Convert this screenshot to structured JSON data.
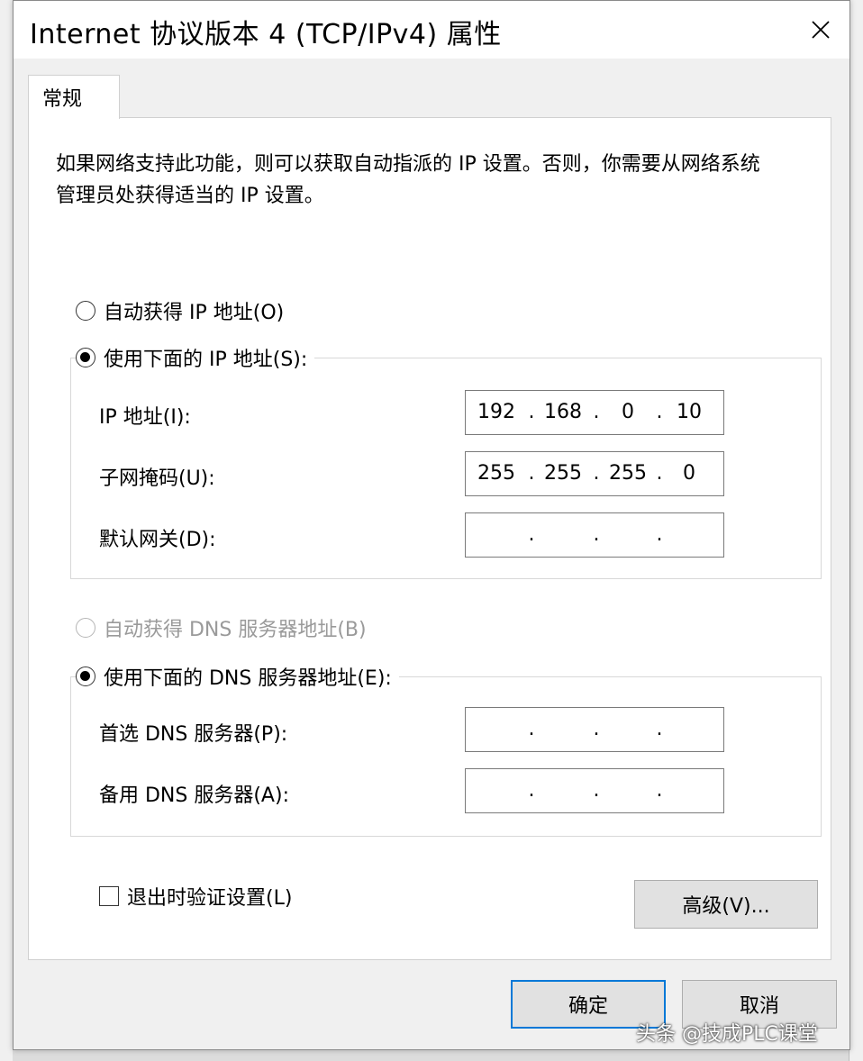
{
  "window": {
    "title": "Internet 协议版本 4 (TCP/IPv4) 属性"
  },
  "tabs": [
    {
      "label": "常规",
      "active": true
    }
  ],
  "description": "如果网络支持此功能，则可以获取自动指派的 IP 设置。否则，你需要从网络系统管理员处获得适当的 IP 设置。",
  "ip_section": {
    "auto_radio": {
      "label": "自动获得 IP 地址(O)",
      "checked": false
    },
    "manual_radio": {
      "label": "使用下面的 IP 地址(S):",
      "checked": true
    },
    "ip_address": {
      "label": "IP 地址(I):",
      "octets": [
        "192",
        "168",
        "0",
        "10"
      ]
    },
    "subnet_mask": {
      "label": "子网掩码(U):",
      "octets": [
        "255",
        "255",
        "255",
        "0"
      ]
    },
    "default_gateway": {
      "label": "默认网关(D):",
      "octets": [
        "",
        "",
        "",
        ""
      ]
    }
  },
  "dns_section": {
    "auto_radio": {
      "label": "自动获得 DNS 服务器地址(B)",
      "checked": false,
      "disabled": true
    },
    "manual_radio": {
      "label": "使用下面的 DNS 服务器地址(E):",
      "checked": true
    },
    "preferred": {
      "label": "首选 DNS 服务器(P):",
      "octets": [
        "",
        "",
        "",
        ""
      ]
    },
    "alternate": {
      "label": "备用 DNS 服务器(A):",
      "octets": [
        "",
        "",
        "",
        ""
      ]
    }
  },
  "validate_checkbox": {
    "label": "退出时验证设置(L)",
    "checked": false
  },
  "buttons": {
    "advanced": "高级(V)...",
    "ok": "确定",
    "cancel": "取消"
  },
  "watermark": "头条 @技成PLC课堂",
  "colors": {
    "accent": "#0078d7",
    "dialog_bg": "#f0f0f0",
    "panel_bg": "#ffffff",
    "disabled_text": "#9a9a9a"
  }
}
